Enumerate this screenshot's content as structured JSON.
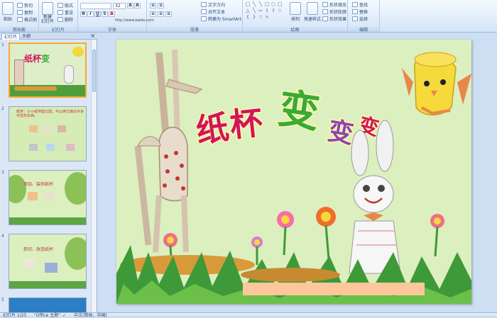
{
  "ribbon": {
    "clipboard": {
      "paste": "粘贴",
      "cut": "剪切",
      "copy": "复制",
      "painter": "格式刷",
      "label": "剪贴板"
    },
    "slides": {
      "new_slide": "新建\n幻灯片",
      "layout": "版式",
      "reset": "重设",
      "delete": "删除",
      "label": "幻灯片"
    },
    "font": {
      "font_name": "",
      "font_size": "32",
      "url_text": "http://www.baidu.com",
      "label": "字体"
    },
    "paragraph": {
      "text_direction": "文字方向",
      "align_text": "对齐文本",
      "smartart": "转换为 SmartArt",
      "label": "段落"
    },
    "drawing": {
      "arrange": "排列",
      "quick_styles": "快速样式",
      "shape_fill": "形状填充",
      "shape_outline": "形状轮廓",
      "shape_effects": "形状效果",
      "label": "绘图"
    },
    "editing": {
      "find": "查找",
      "replace": "替换",
      "select": "选择",
      "label": "编辑"
    }
  },
  "panel": {
    "tabs": [
      "幻灯片",
      "大纲"
    ],
    "close": "×",
    "slides": [
      {
        "num": "1"
      },
      {
        "num": "2",
        "text": "纸杯：小小纸杯圆又圆，可以用它做出许多可爱的东西。"
      },
      {
        "num": "3",
        "text": "添加、装饰纸杯"
      },
      {
        "num": "4",
        "text": "剪切、改造纸杯"
      },
      {
        "num": "5"
      }
    ]
  },
  "slide": {
    "title_chars": [
      "纸",
      "杯",
      "变",
      "变",
      "变"
    ],
    "title_colors": [
      "#d2145a",
      "#d2145a",
      "#3aaa35",
      "#8e44ad",
      "#d2145a"
    ],
    "colors": {
      "bg": "#dcefbf",
      "grass": "#3e9a38",
      "dirt": "#d89a3a",
      "pink_bar": "#fcc79a"
    }
  },
  "status": {
    "slide_info": "幻灯片 1/25",
    "theme": "\"Office 主题\"",
    "language": "中文(简体，中国)"
  }
}
